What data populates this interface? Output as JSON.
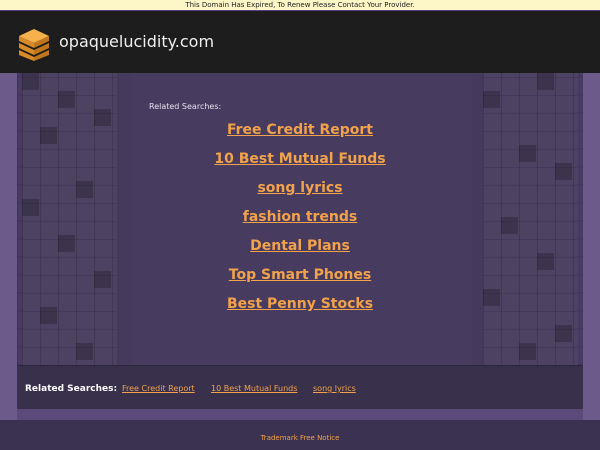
{
  "banner": {
    "text": "This Domain Has Expired, To Renew Please Contact Your Provider."
  },
  "header": {
    "site_name": "opaquelucidity.com",
    "logo_icon": "stacked-cube-logo-icon"
  },
  "main": {
    "related_label": "Related Searches:",
    "links": [
      "Free Credit Report",
      "10 Best Mutual Funds",
      "song lyrics",
      "fashion trends",
      "Dental Plans",
      "Top Smart Phones",
      "Best Penny Stocks"
    ]
  },
  "related_bar": {
    "label": "Related Searches:",
    "links": [
      "Free Credit Report",
      "10 Best Mutual Funds",
      "song lyrics"
    ]
  },
  "footer": {
    "trademark": "Trademark Free Notice"
  },
  "colors": {
    "accent_link": "#f2a24a",
    "background": "#5b4a7a",
    "header_bg": "#1d1d1d",
    "banner_bg": "#fdf6c6"
  }
}
